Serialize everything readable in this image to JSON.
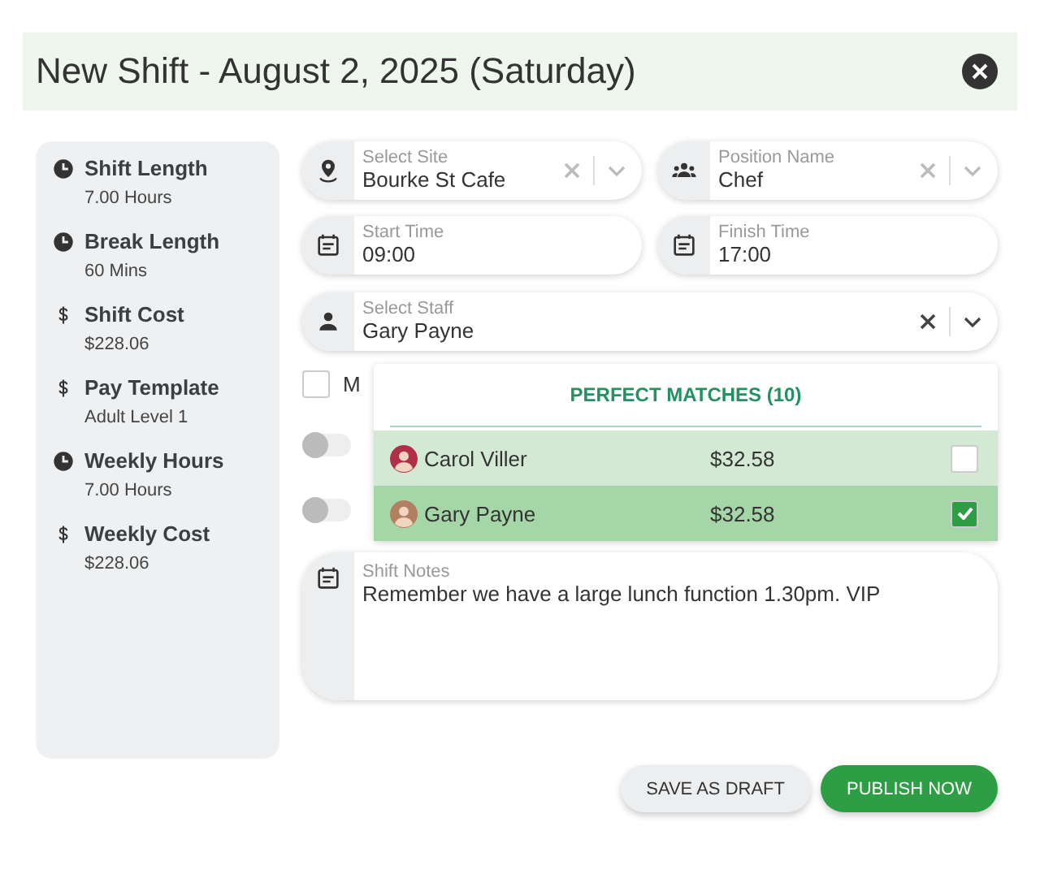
{
  "window": {
    "title": "New Shift - August 2, 2025 (Saturday)"
  },
  "summary": [
    {
      "kind": "time",
      "label": "Shift Length",
      "value": "7.00 Hours"
    },
    {
      "kind": "time",
      "label": "Break Length",
      "value": "60 Mins"
    },
    {
      "kind": "money",
      "label": "Shift Cost",
      "value": "$228.06"
    },
    {
      "kind": "money",
      "label": "Pay Template",
      "value": "Adult Level 1"
    },
    {
      "kind": "time",
      "label": "Weekly Hours",
      "value": "7.00 Hours"
    },
    {
      "kind": "money",
      "label": "Weekly Cost",
      "value": "$228.06"
    }
  ],
  "fields": [
    {
      "label": "Select Site",
      "value": "Bourke St Cafe",
      "kind": "select"
    },
    {
      "label": "Position Name",
      "value": "Chef",
      "kind": "select"
    },
    {
      "label": "Start Time",
      "value": "09:00",
      "kind": "text"
    },
    {
      "label": "Finish Time",
      "value": "17:00",
      "kind": "text"
    }
  ],
  "staff": {
    "label": "Select Staff",
    "value": "Gary Payne"
  },
  "checkbox": {
    "label": "M",
    "checked": false
  },
  "toggles": [
    {
      "on": false
    },
    {
      "on": false
    }
  ],
  "dropdown": {
    "heading": "PERFECT MATCHES (10)",
    "options": [
      {
        "name": "Carol Viller",
        "rate": "$32.58",
        "selected": false,
        "checked": false
      },
      {
        "name": "Gary Payne",
        "rate": "$32.58",
        "selected": true,
        "checked": true
      }
    ]
  },
  "notes": {
    "label": "Shift Notes",
    "value": "Remember we have a large lunch function 1.30pm. VIP"
  },
  "buttons": [
    {
      "label": "SAVE AS DRAFT",
      "kind": "secondary"
    },
    {
      "label": "PUBLISH NOW",
      "kind": "primary"
    }
  ]
}
